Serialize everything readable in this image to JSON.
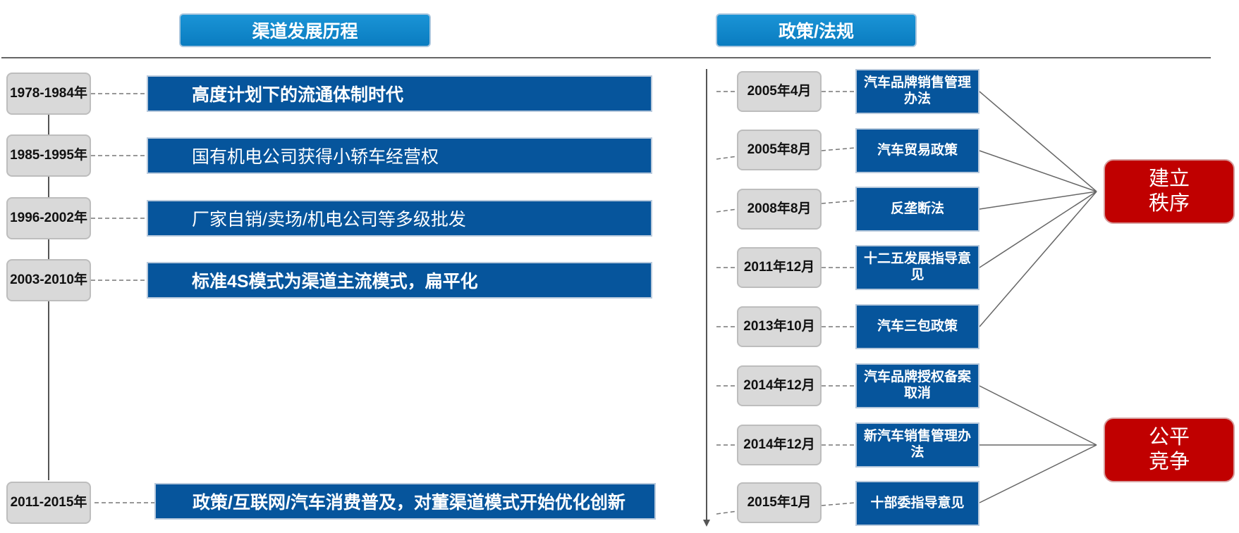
{
  "headers": {
    "left": "渠道发展历程",
    "right": "政策/法规"
  },
  "timeline": [
    {
      "period": "1978-1984年",
      "text": "高度计划下的流通体制时代",
      "bold": true
    },
    {
      "period": "1985-1995年",
      "text": "国有机电公司获得小轿车经营权",
      "bold": false
    },
    {
      "period": "1996-2002年",
      "text": "厂家自销/卖场/机电公司等多级批发",
      "bold": false
    },
    {
      "period": "2003-2010年",
      "text": "标准4S模式为渠道主流模式，扁平化",
      "bold": true
    },
    {
      "period": "2011-2015年",
      "text": "政策/互联网/汽车消费普及，对董渠道模式开始优化创新",
      "bold": true
    }
  ],
  "policies": [
    {
      "date": "2005年4月",
      "name": "汽车品牌销售管理办法"
    },
    {
      "date": "2005年8月",
      "name": "汽车贸易政策"
    },
    {
      "date": "2008年8月",
      "name": "反垄断法"
    },
    {
      "date": "2011年12月",
      "name": "十二五发展指导意见"
    },
    {
      "date": "2013年10月",
      "name": "汽车三包政策"
    },
    {
      "date": "2014年12月",
      "name": "汽车品牌授权备案取消"
    },
    {
      "date": "2014年12月",
      "name": "新汽车销售管理办法"
    },
    {
      "date": "2015年1月",
      "name": "十部委指导意见"
    }
  ],
  "outcomes": [
    {
      "label": "建立秩序"
    },
    {
      "label": "公平竞争"
    }
  ],
  "colors": {
    "header": "#0a86ca",
    "bar": "#06559c",
    "outcome": "#c00000",
    "date_box": "#d9d9d9"
  }
}
